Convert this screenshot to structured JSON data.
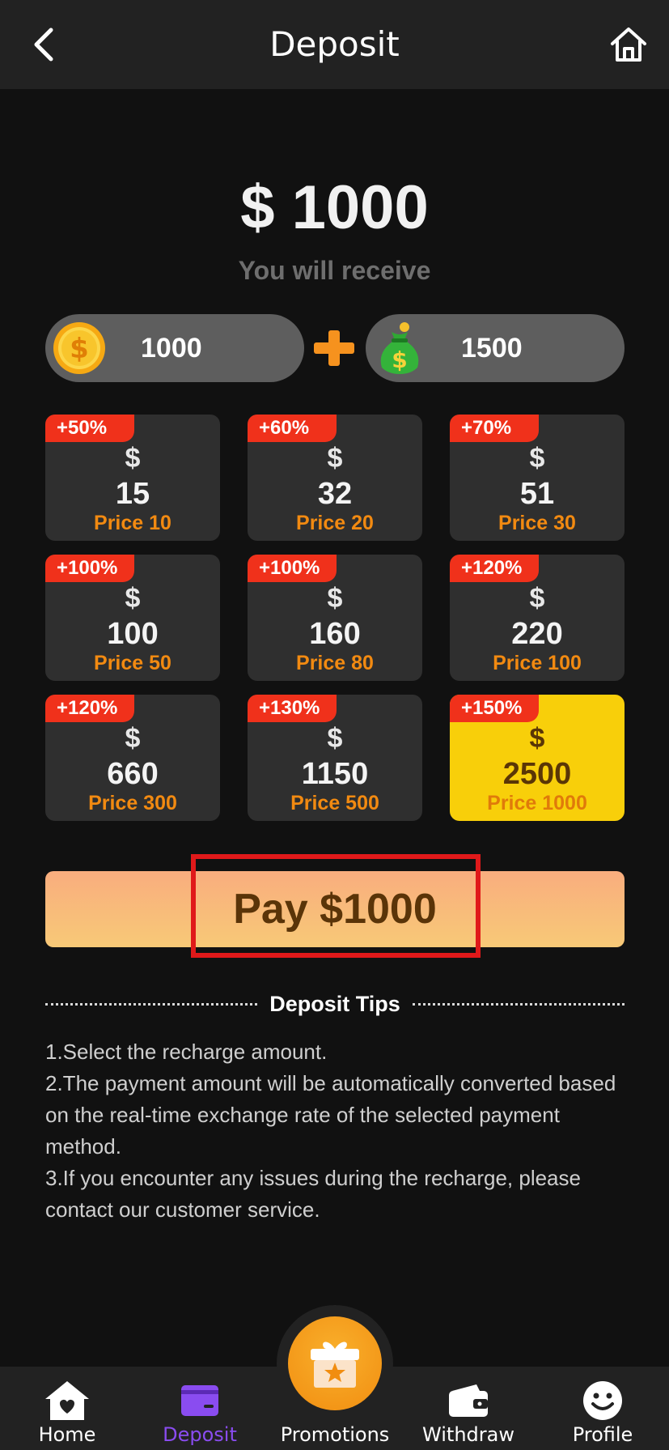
{
  "header": {
    "title": "Deposit",
    "back_icon": "chevron-left-icon",
    "home_icon": "home-outline-icon"
  },
  "summary": {
    "amount": "$ 1000",
    "receive_label": "You will receive",
    "coins_value": "1000",
    "bonus_value": "1500",
    "coin_icon": "gold-coin-icon",
    "plus_icon": "plus-icon",
    "bonus_icon": "money-bag-icon"
  },
  "packages": [
    {
      "bonus": "+50%",
      "currency": "$",
      "amount": "15",
      "price": "Price 10",
      "selected": false
    },
    {
      "bonus": "+60%",
      "currency": "$",
      "amount": "32",
      "price": "Price 20",
      "selected": false
    },
    {
      "bonus": "+70%",
      "currency": "$",
      "amount": "51",
      "price": "Price 30",
      "selected": false
    },
    {
      "bonus": "+100%",
      "currency": "$",
      "amount": "100",
      "price": "Price 50",
      "selected": false
    },
    {
      "bonus": "+100%",
      "currency": "$",
      "amount": "160",
      "price": "Price 80",
      "selected": false
    },
    {
      "bonus": "+120%",
      "currency": "$",
      "amount": "220",
      "price": "Price 100",
      "selected": false
    },
    {
      "bonus": "+120%",
      "currency": "$",
      "amount": "660",
      "price": "Price 300",
      "selected": false
    },
    {
      "bonus": "+130%",
      "currency": "$",
      "amount": "1150",
      "price": "Price 500",
      "selected": false
    },
    {
      "bonus": "+150%",
      "currency": "$",
      "amount": "2500",
      "price": "Price 1000",
      "selected": true
    }
  ],
  "pay": {
    "label": "Pay $1000"
  },
  "tips": {
    "title": "Deposit Tips",
    "lines": [
      "1.Select the recharge amount.",
      "2.The payment amount will be automatically converted based on the real-time exchange rate of the selected payment method.",
      "3.If you encounter any issues during the recharge, please contact our customer service."
    ]
  },
  "nav": {
    "items": [
      {
        "label": "Home",
        "icon": "home-heart-icon"
      },
      {
        "label": "Deposit",
        "icon": "wallet-card-icon",
        "active": true
      },
      {
        "label": "Promotions",
        "icon": "gift-star-icon"
      },
      {
        "label": "Withdraw",
        "icon": "wallet-icon"
      },
      {
        "label": "Profile",
        "icon": "smiley-icon"
      }
    ]
  },
  "colors": {
    "background": "#111111",
    "bar": "#222222",
    "accent_purple": "#8a4cf0",
    "bonus_red": "#f0311b",
    "price_orange": "#f28a11",
    "selected_yellow": "#f8cf0a"
  }
}
